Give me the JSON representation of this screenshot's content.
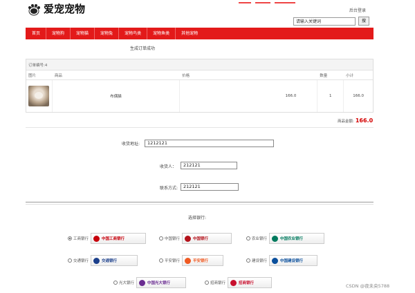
{
  "header": {
    "site_title": "爱宠宠物",
    "admin_login": "后台登录",
    "search_placeholder": "请输入关键词",
    "search_value": "请输入关键词",
    "search_button": "搜"
  },
  "nav": [
    {
      "label": "首页"
    },
    {
      "label": "宠物狗"
    },
    {
      "label": "宠物猫"
    },
    {
      "label": "宠物兔"
    },
    {
      "label": "宠物鸟类"
    },
    {
      "label": "宠物鱼类"
    },
    {
      "label": "其他宠物"
    }
  ],
  "order": {
    "success_message": "生成订单成功",
    "order_number_label": "订单编号:4",
    "columns": [
      "图片",
      "商品",
      "价格",
      "数量",
      "小计"
    ],
    "items": [
      {
        "name": "布偶猫",
        "price": "166.0",
        "qty": "1",
        "subtotal": "166.0"
      }
    ],
    "total_label": "商品金额:",
    "total_value": "166.0"
  },
  "form": {
    "address_label": "收货地址:",
    "address_value": "1212121",
    "receiver_label": "收货人：",
    "receiver_value": "212121",
    "contact_label": "联系方式:",
    "contact_value": "212121"
  },
  "payment": {
    "title": "选择银行:",
    "banks": [
      {
        "name": "工商银行",
        "logo_text": "中国工商银行",
        "color": "#c7000b",
        "checked": true
      },
      {
        "name": "中国银行",
        "logo_text": "中国银行",
        "color": "#b4121b",
        "checked": false
      },
      {
        "name": "农业银行",
        "logo_text": "中国农业银行",
        "color": "#007a5e",
        "checked": false
      },
      {
        "name": "交通银行",
        "logo_text": "交通银行",
        "color": "#1b3f8b",
        "checked": false
      },
      {
        "name": "平安银行",
        "logo_text": "平安银行",
        "color": "#f05a22",
        "checked": false
      },
      {
        "name": "建设银行",
        "logo_text": "中国建设银行",
        "color": "#0a4f9c",
        "checked": false
      },
      {
        "name": "光大银行",
        "logo_text": "中国光大银行",
        "color": "#6a2c91",
        "checked": false
      },
      {
        "name": "招商银行",
        "logo_text": "招商银行",
        "color": "#c8102e",
        "checked": false
      }
    ]
  },
  "watermark": "CSDN @夜未央5788",
  "colors": {
    "nav_bg": "#e31a1a",
    "price_red": "#d40000"
  }
}
